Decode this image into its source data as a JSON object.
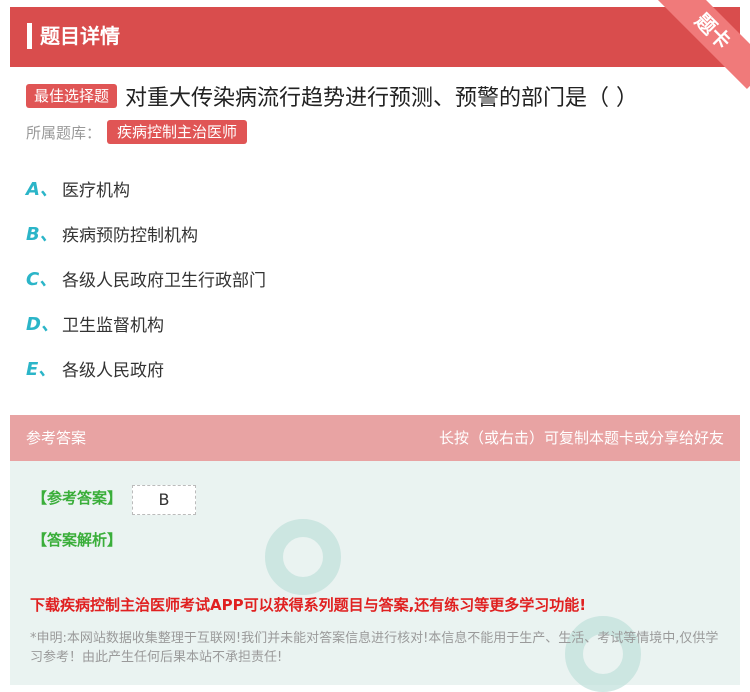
{
  "header": {
    "title": "题目详情",
    "ribbon": "题卡"
  },
  "question": {
    "tag": "最佳选择题",
    "text": "对重大传染病流行趋势进行预测、预警的部门是（ ）",
    "bank_label": "所属题库：",
    "bank_name": "疾病控制主治医师"
  },
  "options": [
    {
      "letter": "A、",
      "text": "医疗机构"
    },
    {
      "letter": "B、",
      "text": "疾病预防控制机构"
    },
    {
      "letter": "C、",
      "text": "各级人民政府卫生行政部门"
    },
    {
      "letter": "D、",
      "text": "卫生监督机构"
    },
    {
      "letter": "E、",
      "text": "各级人民政府"
    }
  ],
  "answer_bar": {
    "left": "参考答案",
    "right": "长按（或右击）可复制本题卡或分享给好友"
  },
  "answer": {
    "answer_label": "【参考答案】",
    "answer_value": "B",
    "analysis_label": "【答案解析】",
    "download": "下载疾病控制主治医师考试APP可以获得系列题目与答案,还有练习等更多学习功能!",
    "disclaimer": "*申明:本网站数据收集整理于互联网!我们并未能对答案信息进行核对!本信息不能用于生产、生活、考试等情境中,仅供学习参考！由此产生任何后果本站不承担责任!"
  }
}
